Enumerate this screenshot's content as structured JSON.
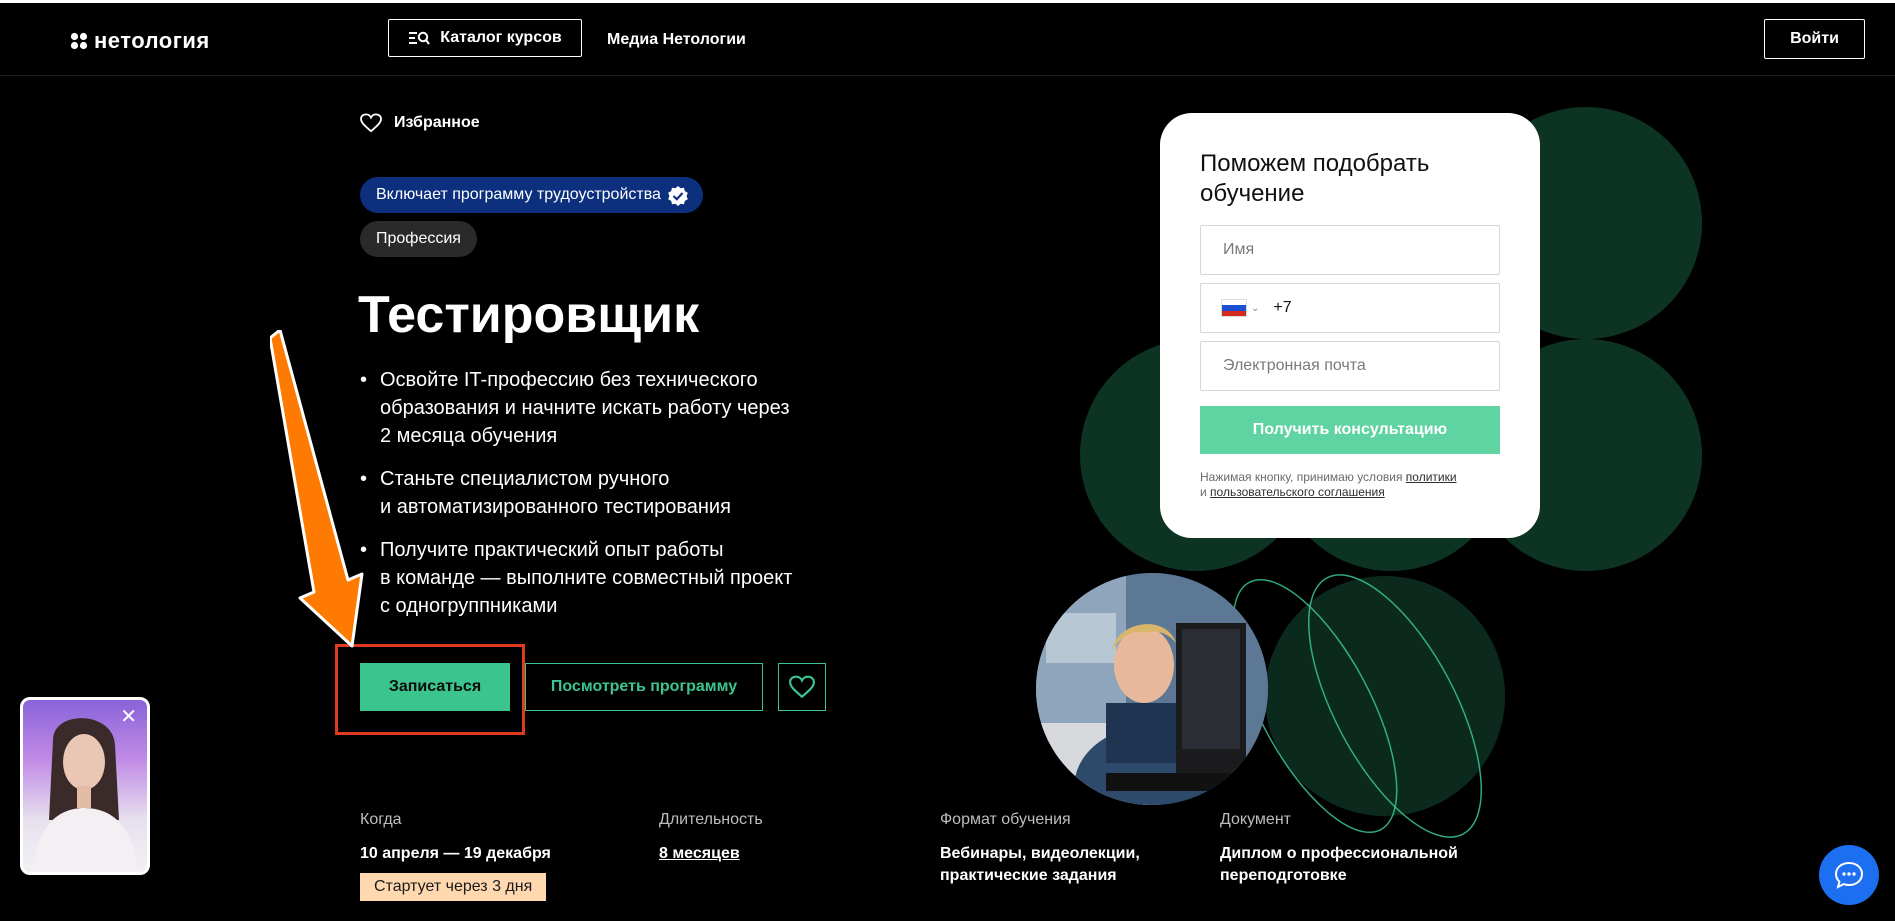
{
  "header": {
    "logo_text": "нетология",
    "catalog_label": "Каталог курсов",
    "media_label": "Медиа Нетологии",
    "login_label": "Войти"
  },
  "hero": {
    "favorites_label": "Избранное",
    "employment_badge": "Включает программу трудоустройства",
    "profession_badge": "Профессия",
    "title": "Тестировщик",
    "bullets": [
      {
        "line1": "Освойте IT-профессию без технического",
        "line2": "образования и начните искать работу через",
        "line3": "2 месяца обучения"
      },
      {
        "line1": "Станьте специалистом ручного",
        "line2": "и автоматизированного тестирования"
      },
      {
        "line1": "Получите практический опыт работы",
        "line2": "в команде — выполните совместный проект",
        "line3": "с одногруппниками"
      }
    ],
    "enroll_label": "Записаться",
    "program_label": "Посмотреть программу"
  },
  "info": {
    "when_label": "Когда",
    "when_value": "10 апреля — 19 декабря",
    "start_chip": "Стартует через 3 дня",
    "duration_label": "Длительность",
    "duration_value": "8 месяцев",
    "format_label": "Формат обучения",
    "format_line1": "Вебинары, видеолекции,",
    "format_line2": "практические задания",
    "document_label": "Документ",
    "document_line1": "Диплом о профессиональной",
    "document_line2": "переподготовке"
  },
  "form": {
    "title": "Поможем подобрать обучение",
    "name_placeholder": "Имя",
    "phone_prefix": "+7",
    "email_placeholder": "Электронная почта",
    "submit_label": "Получить консультацию",
    "terms_prefix": "Нажимая кнопку, принимаю условия ",
    "terms_policy": "политики",
    "terms_and": "и ",
    "terms_agreement": "пользовательского соглашения"
  },
  "colors": {
    "accent": "#3cc48f",
    "badge_blue": "#0c2f7e",
    "annotation_arrow": "#ff7a00",
    "annotation_box": "#e03a1f",
    "chat": "#1c6ff0"
  },
  "icons": {
    "favorites": "heart-icon",
    "catalog": "search-list-icon",
    "verified": "check-badge-icon",
    "chat": "chat-bubble-icon",
    "close": "close-icon"
  }
}
